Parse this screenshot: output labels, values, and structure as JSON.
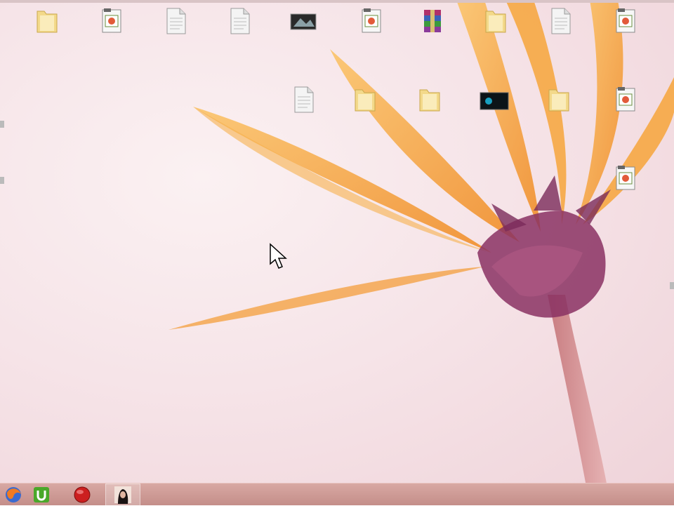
{
  "desktop": {
    "icons": [
      {
        "name": "folder-icon-1",
        "label": "",
        "type": "folder"
      },
      {
        "name": "video-file-icon-1",
        "label": "",
        "type": "video"
      },
      {
        "name": "document-icon-1",
        "label": "",
        "type": "doc"
      },
      {
        "name": "document-icon-2",
        "label": "",
        "type": "doc"
      },
      {
        "name": "image-file-icon-1",
        "label": "",
        "type": "image"
      },
      {
        "name": "video-file-icon-2",
        "label": "",
        "type": "video"
      },
      {
        "name": "winrar-archive-icon",
        "label": "",
        "type": "rar"
      },
      {
        "name": "folder-icon-2",
        "label": "",
        "type": "folder"
      },
      {
        "name": "document-icon-3",
        "label": "",
        "type": "doc"
      },
      {
        "name": "video-file-icon-3",
        "label": "",
        "type": "video"
      },
      {
        "name": "document-icon-4",
        "label": "",
        "type": "doc"
      },
      {
        "name": "folder-icon-3",
        "label": "",
        "type": "folder"
      },
      {
        "name": "folder-icon-4",
        "label": "",
        "type": "folder"
      },
      {
        "name": "video-thumbnail-icon",
        "label": "",
        "type": "darkvideo"
      },
      {
        "name": "folder-icon-5",
        "label": "",
        "type": "folder"
      },
      {
        "name": "video-file-icon-4",
        "label": "",
        "type": "video"
      },
      {
        "name": "video-file-icon-5",
        "label": "",
        "type": "video"
      }
    ],
    "cursor": "mouse-pointer-icon"
  },
  "taskbar": {
    "buttons": [
      {
        "name": "firefox-taskbar-icon",
        "active": false
      },
      {
        "name": "utorrent-taskbar-icon",
        "active": false
      },
      {
        "name": "record-taskbar-icon",
        "active": false
      },
      {
        "name": "user-photo-taskbar-icon",
        "active": true
      }
    ]
  },
  "colors": {
    "taskbar": "#c9948f",
    "petal": "#f6a53a",
    "flower_center": "#7a2a5a"
  }
}
